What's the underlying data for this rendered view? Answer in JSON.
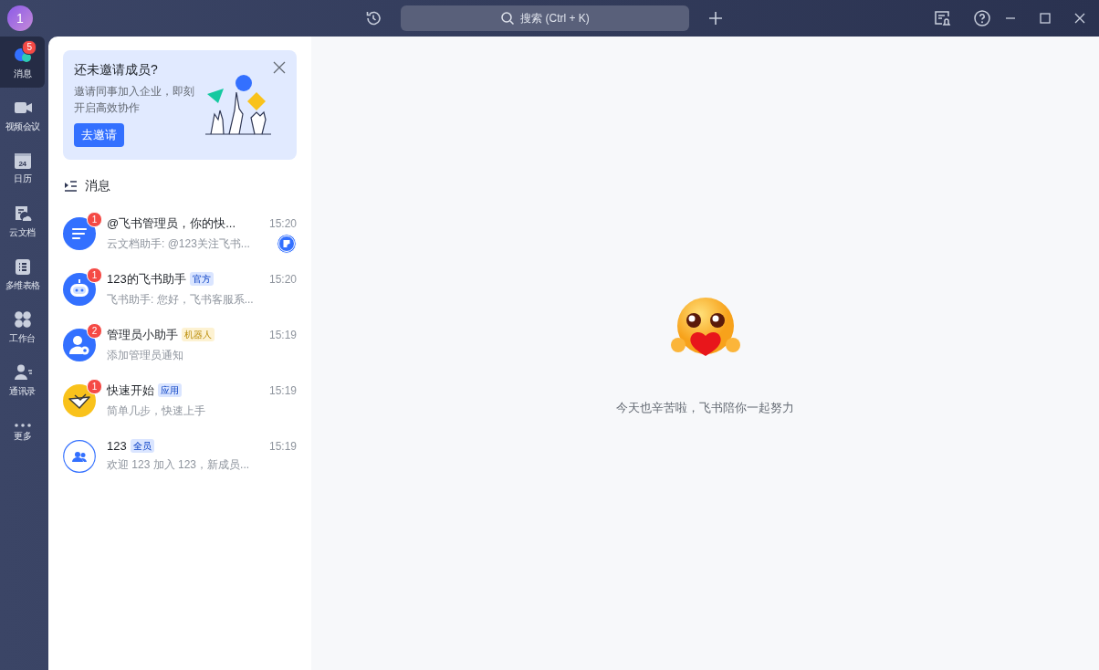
{
  "titlebar": {
    "avatar": "1",
    "search": {
      "placeholder": "搜索 (Ctrl + K)"
    }
  },
  "nav": [
    {
      "kind": "chat",
      "label": "消息",
      "selected": true,
      "badge": "5"
    },
    {
      "kind": "video",
      "label": "视频会议",
      "selected": false
    },
    {
      "kind": "calendar",
      "label": "日历",
      "selected": false,
      "icon_text": "24"
    },
    {
      "kind": "docs",
      "label": "云文档",
      "selected": false
    },
    {
      "kind": "table",
      "label": "多维表格",
      "selected": false
    },
    {
      "kind": "apps",
      "label": "工作台",
      "selected": false
    },
    {
      "kind": "contacts",
      "label": "通讯录",
      "selected": false
    },
    {
      "kind": "more",
      "label": "更多",
      "selected": false
    }
  ],
  "invite_card": {
    "title": "还未邀请成员?",
    "body": "邀请同事加入企业，即刻开启高效协作",
    "button": "去邀请"
  },
  "section_title": "消息",
  "chats": [
    {
      "kind": "doc",
      "title": "@飞书管理员，你的快...",
      "time": "15:20",
      "preview": "云文档助手: @123关注飞书...",
      "unread": "1",
      "doc_indicator": true
    },
    {
      "kind": "bot",
      "title": "123的飞书助手",
      "tag": {
        "text": "官方",
        "color": "#dae5ff"
      },
      "time": "15:20",
      "preview": "飞书助手: 您好，飞书客服系...",
      "unread": "1",
      "doc_indicator": false
    },
    {
      "kind": "admin",
      "title": "管理员小助手",
      "tag": {
        "text": "机器人",
        "color": "#fdf2d2"
      },
      "time": "15:19",
      "preview": "添加管理员通知",
      "unread": "2",
      "doc_indicator": false
    },
    {
      "kind": "onboarding",
      "title": "快速开始",
      "tag": {
        "text": "应用",
        "color": "#dae5ff"
      },
      "time": "15:19",
      "preview": "简单几步，快速上手",
      "unread": "1",
      "doc_indicator": false
    },
    {
      "kind": "group",
      "title": "123",
      "tag": {
        "text": "全员",
        "color": "#dae5ff"
      },
      "time": "15:19",
      "preview": "欢迎 123 加入 123，新成员...",
      "doc_indicator": false
    }
  ],
  "empty_state": {
    "text": "今天也辛苦啦，飞书陪你一起努力"
  }
}
